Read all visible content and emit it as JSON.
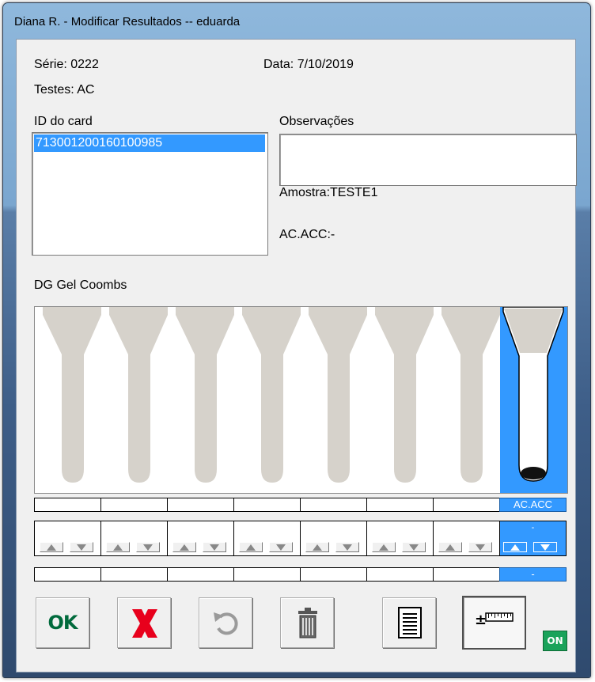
{
  "window": {
    "title": "Diana R. - Modificar Resultados -- eduarda"
  },
  "info": {
    "serie_label": "Série: 0222",
    "data_label": "Data: 7/10/2019",
    "testes_label": "Testes: AC"
  },
  "card_list": {
    "header": "ID do card",
    "items": [
      "713001200160100985"
    ],
    "selected_index": 0
  },
  "observations": {
    "header": "Observações",
    "value": "",
    "amostra": "Amostra:TESTE1",
    "result_line": "AC.ACC:-"
  },
  "gel": {
    "header": "DG Gel Coombs",
    "tube_count": 8,
    "selected_well_label": "AC.ACC",
    "selected_result": "-",
    "bottom_value": "-"
  },
  "toolbar": {
    "ok_label": "OK",
    "buttons": [
      "ok-button",
      "cancel-button",
      "undo-button",
      "delete-button",
      "report-button",
      "adjust-button"
    ]
  },
  "status": {
    "on_label": "ON",
    "on_color": "#1aa35a"
  },
  "colors": {
    "selection": "#3399ff",
    "tube": "#d6d2cb",
    "cancel_x": "#e8001c",
    "ok_green": "#006a3c"
  }
}
